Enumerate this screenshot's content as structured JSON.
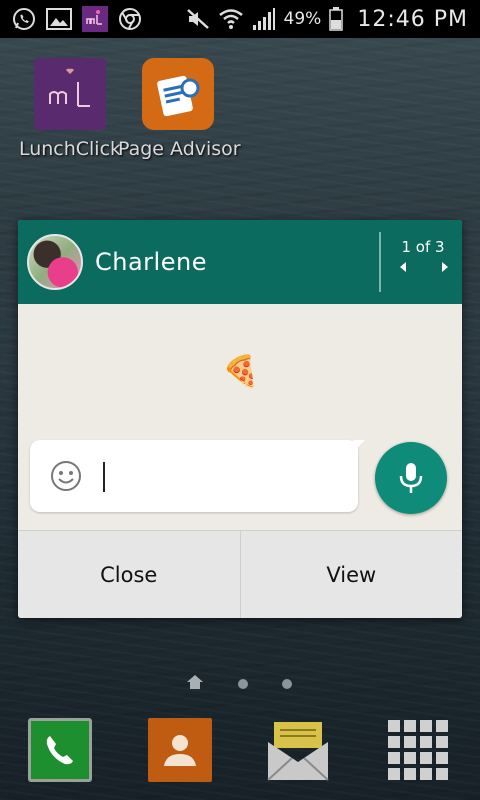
{
  "status_bar": {
    "battery_percent": "49%",
    "time": "12:46 PM",
    "icons": [
      "whatsapp-icon",
      "gallery-icon",
      "lunchclick-notification-icon",
      "chrome-icon",
      "mute-icon",
      "wifi-icon",
      "signal-icon",
      "battery-icon"
    ]
  },
  "desktop_apps": [
    {
      "label": "LunchClick",
      "icon": "lunchclick-icon",
      "color": "#5a2a6e"
    },
    {
      "label": "Page Advisor",
      "icon": "page-advisor-icon",
      "color": "#d46a14"
    }
  ],
  "popup": {
    "contact_name": "Charlene",
    "pager": "1 of 3",
    "message_emoji": "🍕",
    "reply_placeholder": "",
    "buttons": {
      "close": "Close",
      "view": "View"
    },
    "accent_color": "#0b6b5f",
    "mic_color": "#0f8c79"
  },
  "home_indicator": {
    "pages": 3,
    "current": "home"
  },
  "dock": [
    {
      "name": "phone",
      "icon": "phone-icon"
    },
    {
      "name": "contacts",
      "icon": "contacts-icon"
    },
    {
      "name": "messages",
      "icon": "envelope-icon"
    },
    {
      "name": "apps",
      "icon": "app-grid-icon"
    }
  ]
}
